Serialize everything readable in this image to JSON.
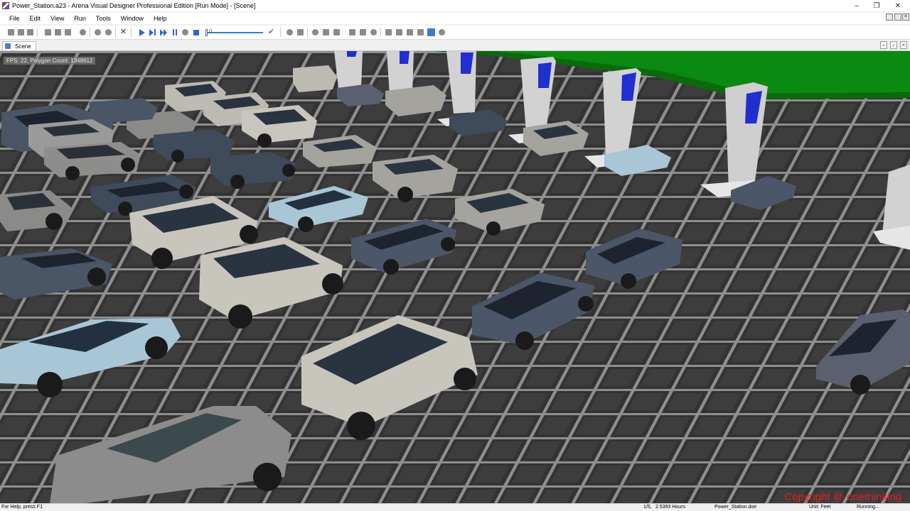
{
  "window": {
    "title": "Power_Station.a23 - Arena Visual Designer Professional Edition [Run Mode] - [Scene]",
    "minimize": "–",
    "maximize": "❐",
    "close": "✕"
  },
  "menu": [
    "File",
    "Edit",
    "View",
    "Run",
    "Tools",
    "Window",
    "Help"
  ],
  "toolbar": {
    "slider_value": "0"
  },
  "tabs": [
    {
      "label": "Scene"
    }
  ],
  "scene": {
    "fps_text": "FPS: 22, Polygon Count: 1348612",
    "watermark": "Copyright @ onethinking",
    "colors": {
      "grass": "#0a8a10",
      "floor": "#3a3a3a",
      "grid": "#9a9a9a",
      "screen": "#1f2fd0"
    }
  },
  "status": {
    "help": "For Help, press F1",
    "progress": "1/5,",
    "time": "2.5393 Hours",
    "file": "Power_Station.doe",
    "unit": "Unit: Feet",
    "state": "Running..."
  }
}
